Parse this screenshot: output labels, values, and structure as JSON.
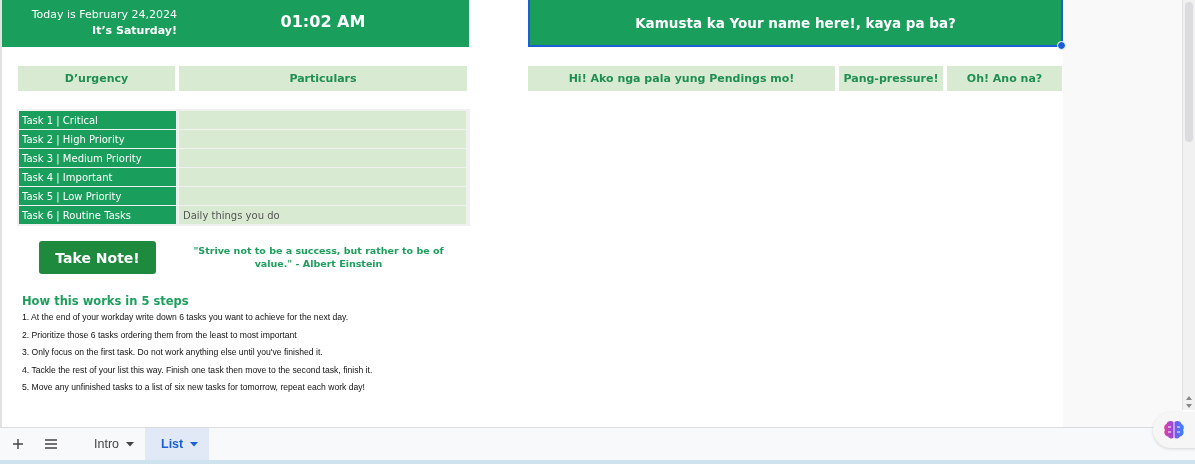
{
  "header": {
    "date": "Today is February 24,2024",
    "day": "It’s Saturday!",
    "time": "01:02 AM"
  },
  "greeting": {
    "text": "Kamusta ka Your name here!, kaya pa ba?",
    "selected": true
  },
  "task_table": {
    "columns": [
      "D’urgency",
      "Particulars"
    ],
    "rows": [
      {
        "task": "Task 1 | Critical"
      },
      {
        "task": "Task 2 | High Priority"
      },
      {
        "task": "Task 3 | Medium Priority"
      },
      {
        "task": "Task 4 | Important"
      },
      {
        "task": "Task 5 | Low Priority"
      },
      {
        "task": "Task 6 | Routine Tasks",
        "particulars": "Daily things you do"
      }
    ]
  },
  "pending_table": {
    "columns": [
      "Hi! Ako nga pala yung Pendings mo!",
      "Pang-pressure!",
      "Oh! Ano na?"
    ]
  },
  "take_note_button": "Take Note!",
  "quote": "\"Strive not to be a success, but rather to be of value.\" - Albert Einstein",
  "steps": {
    "title": "How this works in 5 steps",
    "items": [
      "1. At the end of your workday write down 6 tasks you want to achieve for the next day.",
      "2. Prioritize those 6 tasks ordering them from the least to most important",
      "3. Only focus on the first task. Do not work anything else until you've finished it.",
      "4. Tackle the rest of your list this way. Finish one task then move to the second task, finish it.",
      "5. Move any unfinished tasks to a list of six new tasks for tomorrow, repeat each work day!"
    ]
  },
  "sheet_tabs": [
    {
      "label": "Intro",
      "selected": false
    },
    {
      "label": "List",
      "selected": true
    }
  ]
}
